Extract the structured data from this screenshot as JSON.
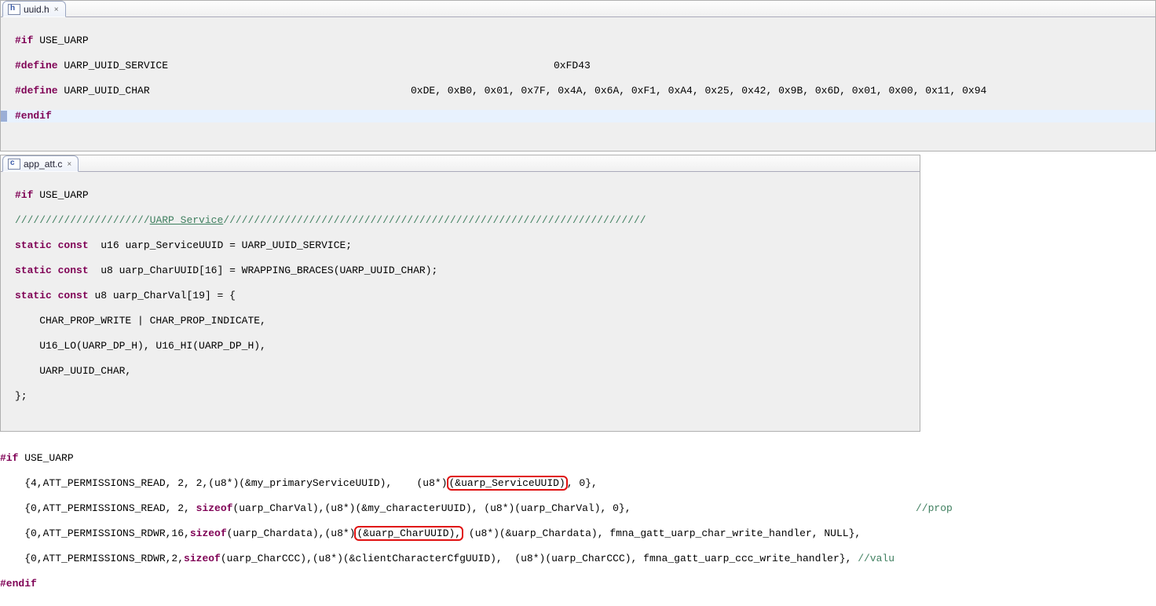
{
  "tabs": {
    "uuid_h": "uuid.h",
    "app_att_c": "app_att.c",
    "close": "×"
  },
  "pane1": {
    "l1_a": "#if",
    "l1_b": " USE_UARP",
    "l2_a": "#define",
    "l2_b": " UARP_UUID_SERVICE",
    "l2_val": "0xFD43",
    "l3_a": "#define",
    "l3_b": " UARP_UUID_CHAR",
    "l3_val": "0xDE, 0xB0, 0x01, 0x7F, 0x4A, 0x6A, 0xF1, 0xA4, 0x25, 0x42, 0x9B, 0x6D, 0x01, 0x00, 0x11, 0x94",
    "l4_a": "#endif"
  },
  "pane2": {
    "l1_a": "#if",
    "l1_b": " USE_UARP",
    "l2_a": "//////////////////////",
    "l2_b": "UARP Service",
    "l2_c": "/////////////////////////////////////////////////////////////////////",
    "l3_a": "static",
    "l3_b": "const",
    "l3_c": "  u16 uarp_ServiceUUID = UARP_UUID_SERVICE;",
    "l4_a": "static",
    "l4_b": "const",
    "l4_c": "  u8 uarp_CharUUID[16] = WRAPPING_BRACES(UARP_UUID_CHAR);",
    "l5_a": "static",
    "l5_b": "const",
    "l5_c": " u8 uarp_CharVal[19] = {",
    "l6": "    CHAR_PROP_WRITE | CHAR_PROP_INDICATE,",
    "l7": "    U16_LO(UARP_DP_H), U16_HI(UARP_DP_H),",
    "l8": "    UARP_UUID_CHAR,",
    "l9": "};"
  },
  "pane3": {
    "l1_a": "#if",
    "l1_b": " USE_UARP",
    "l2_a": "    {4,ATT_PERMISSIONS_READ, 2, 2,(u8*)(&my_primaryServiceUUID),    (u8*)",
    "l2_box": "(&uarp_ServiceUUID)",
    "l2_c": ", 0},",
    "l3_a": "    {0,ATT_PERMISSIONS_READ, 2, ",
    "l3_b": "sizeof",
    "l3_c": "(uarp_CharVal),(u8*)(&my_characterUUID), (u8*)(uarp_CharVal), 0},",
    "l3_cmt": "//prop",
    "l4_a": "    {0,ATT_PERMISSIONS_RDWR,16,",
    "l4_b": "sizeof",
    "l4_c": "(uarp_Chardata),(u8*)",
    "l4_box": "(&uarp_CharUUID),",
    "l4_d": " (u8*)(&uarp_Chardata), fmna_gatt_uarp_char_write_handler, NULL},",
    "l5_a": "    {0,ATT_PERMISSIONS_RDWR,2,",
    "l5_b": "sizeof",
    "l5_c": "(uarp_CharCCC),(u8*)(&clientCharacterCfgUUID),  (u8*)(uarp_CharCCC), fmna_gatt_uarp_ccc_write_handler}, ",
    "l5_cmt": "//valu",
    "l6_a": "#endif"
  }
}
